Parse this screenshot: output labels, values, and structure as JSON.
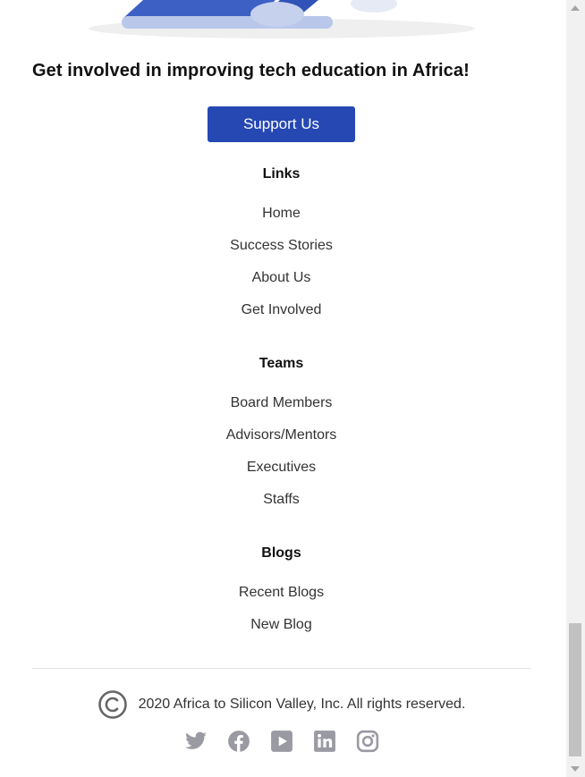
{
  "cta": {
    "heading": "Get involved in improving tech education in Africa!",
    "button_label": "Support Us",
    "button_color": "#2548b3"
  },
  "sections": {
    "links": {
      "title": "Links",
      "items": [
        "Home",
        "Success Stories",
        "About Us",
        "Get Involved"
      ]
    },
    "teams": {
      "title": "Teams",
      "items": [
        "Board Members",
        "Advisors/Mentors",
        "Executives",
        "Staffs"
      ]
    },
    "blogs": {
      "title": "Blogs",
      "items": [
        "Recent Blogs",
        "New Blog"
      ]
    }
  },
  "footer": {
    "copyright_text": "2020 Africa to Silicon Valley, Inc. All rights reserved.",
    "social_icons": [
      "twitter-icon",
      "facebook-icon",
      "youtube-icon",
      "linkedin-icon",
      "instagram-icon"
    ],
    "icon_color": "#9a9aa3"
  }
}
